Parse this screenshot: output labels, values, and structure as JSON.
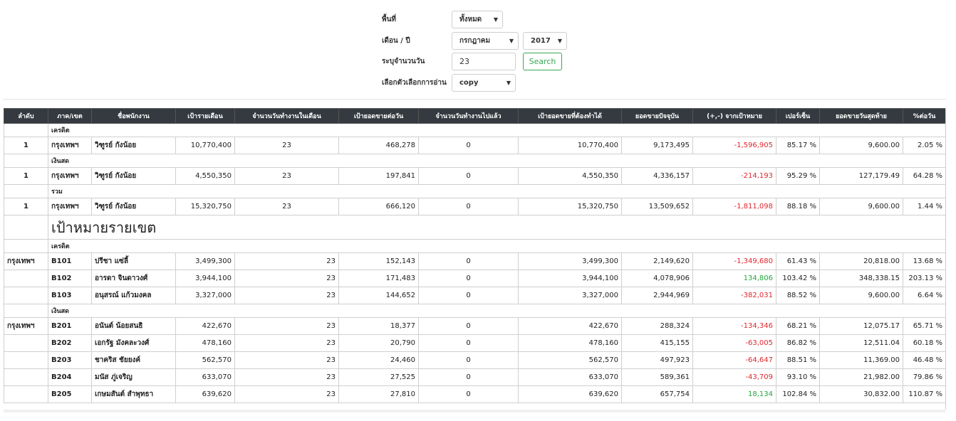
{
  "filters": {
    "area": {
      "label": "พื้นที่",
      "value": "ทั้งหมด"
    },
    "month_year": {
      "label": "เดือน / ปี",
      "month": "กรกฎาคม",
      "year": "2017"
    },
    "days": {
      "label": "ระบุจำนวนวัน",
      "value": "23"
    },
    "search_button": "Search",
    "read_option": {
      "label": "เลือกตัวเลือกการอ่าน",
      "value": "copy"
    }
  },
  "table": {
    "headers": [
      "ลำดับ",
      "ภาค/เขต",
      "ชื่อพนักงาน",
      "เป้ารายเดือน",
      "จำนวนวันทำงานในเดือน",
      "เป้ายอดขายต่อวัน",
      "จำนวนวันทำงานไปแล้ว",
      "เป้ายอดขายที่ต้องทำได้",
      "ยอดขายปัจจุบัน",
      "(+,-) จากเป้าหมาย",
      "เปอร์เซ็น",
      "ยอดขายวันสุดท้าย",
      "%ต่อวัน"
    ],
    "summary": [
      {
        "group": "เครดิต",
        "row": {
          "no": "1",
          "region": "กรุงเทพฯ",
          "name": "วิฑูรย์ กังน้อย",
          "monthly_target": "10,770,400",
          "work_days": "23",
          "daily_target": "468,278",
          "days_worked": "0",
          "target_to_date": "10,770,400",
          "current_sales": "9,173,495",
          "diff": "-1,596,905",
          "percent": "85.17 %",
          "last_day_sales": "9,600.00",
          "daily_percent": "2.05 %"
        }
      },
      {
        "group": "เงินสด",
        "row": {
          "no": "1",
          "region": "กรุงเทพฯ",
          "name": "วิฑูรย์ กังน้อย",
          "monthly_target": "4,550,350",
          "work_days": "23",
          "daily_target": "197,841",
          "days_worked": "0",
          "target_to_date": "4,550,350",
          "current_sales": "4,336,157",
          "diff": "-214,193",
          "percent": "95.29 %",
          "last_day_sales": "127,179.49",
          "daily_percent": "64.28 %"
        }
      },
      {
        "group": "รวม",
        "row": {
          "no": "1",
          "region": "กรุงเทพฯ",
          "name": "วิฑูรย์ กังน้อย",
          "monthly_target": "15,320,750",
          "work_days": "23",
          "daily_target": "666,120",
          "days_worked": "0",
          "target_to_date": "15,320,750",
          "current_sales": "13,509,652",
          "diff": "-1,811,098",
          "percent": "88.18 %",
          "last_day_sales": "9,600.00",
          "daily_percent": "1.44 %"
        }
      }
    ],
    "section_title": "เป้าหมายรายเขต",
    "district_groups": [
      {
        "group": "เครดิต",
        "rows": [
          {
            "region": "กรุงเทพฯ",
            "code": "B101",
            "name": "ปรีชา แซ่ลี้",
            "monthly_target": "3,499,300",
            "work_days": "23",
            "daily_target": "152,143",
            "days_worked": "0",
            "target_to_date": "3,499,300",
            "current_sales": "2,149,620",
            "diff": "-1,349,680",
            "percent": "61.43 %",
            "last_day_sales": "20,818.00",
            "daily_percent": "13.68 %"
          },
          {
            "region": "",
            "code": "B102",
            "name": "อารดา จินดาวงศ์",
            "monthly_target": "3,944,100",
            "work_days": "23",
            "daily_target": "171,483",
            "days_worked": "0",
            "target_to_date": "3,944,100",
            "current_sales": "4,078,906",
            "diff": "134,806",
            "percent": "103.42 %",
            "last_day_sales": "348,338.15",
            "daily_percent": "203.13 %"
          },
          {
            "region": "",
            "code": "B103",
            "name": "อนุสรณ์ แก้วมงคล",
            "monthly_target": "3,327,000",
            "work_days": "23",
            "daily_target": "144,652",
            "days_worked": "0",
            "target_to_date": "3,327,000",
            "current_sales": "2,944,969",
            "diff": "-382,031",
            "percent": "88.52 %",
            "last_day_sales": "9,600.00",
            "daily_percent": "6.64 %"
          }
        ]
      },
      {
        "group": "เงินสด",
        "rows": [
          {
            "region": "กรุงเทพฯ",
            "code": "B201",
            "name": "อนันต์ น้อยสนธิ",
            "monthly_target": "422,670",
            "work_days": "23",
            "daily_target": "18,377",
            "days_worked": "0",
            "target_to_date": "422,670",
            "current_sales": "288,324",
            "diff": "-134,346",
            "percent": "68.21 %",
            "last_day_sales": "12,075.17",
            "daily_percent": "65.71 %"
          },
          {
            "region": "",
            "code": "B202",
            "name": "เอกรัฐ มังคละวงศ์",
            "monthly_target": "478,160",
            "work_days": "23",
            "daily_target": "20,790",
            "days_worked": "0",
            "target_to_date": "478,160",
            "current_sales": "415,155",
            "diff": "-63,005",
            "percent": "86.82 %",
            "last_day_sales": "12,511.04",
            "daily_percent": "60.18 %"
          },
          {
            "region": "",
            "code": "B203",
            "name": "ชาคริส ชัยยงค์",
            "monthly_target": "562,570",
            "work_days": "23",
            "daily_target": "24,460",
            "days_worked": "0",
            "target_to_date": "562,570",
            "current_sales": "497,923",
            "diff": "-64,647",
            "percent": "88.51 %",
            "last_day_sales": "11,369.00",
            "daily_percent": "46.48 %"
          },
          {
            "region": "",
            "code": "B204",
            "name": "มนัส ภู่เจริญ",
            "monthly_target": "633,070",
            "work_days": "23",
            "daily_target": "27,525",
            "days_worked": "0",
            "target_to_date": "633,070",
            "current_sales": "589,361",
            "diff": "-43,709",
            "percent": "93.10 %",
            "last_day_sales": "21,982.00",
            "daily_percent": "79.86 %"
          },
          {
            "region": "",
            "code": "B205",
            "name": "เกษมสันต์ สำพุทธา",
            "monthly_target": "639,620",
            "work_days": "23",
            "daily_target": "27,810",
            "days_worked": "0",
            "target_to_date": "639,620",
            "current_sales": "657,754",
            "diff": "18,134",
            "percent": "102.84 %",
            "last_day_sales": "30,832.00",
            "daily_percent": "110.87 %"
          }
        ]
      }
    ]
  },
  "colors": {
    "header_bg": "#343a40",
    "negative": "#e0262e",
    "positive": "#1fa83a",
    "button": "#3aa655"
  }
}
